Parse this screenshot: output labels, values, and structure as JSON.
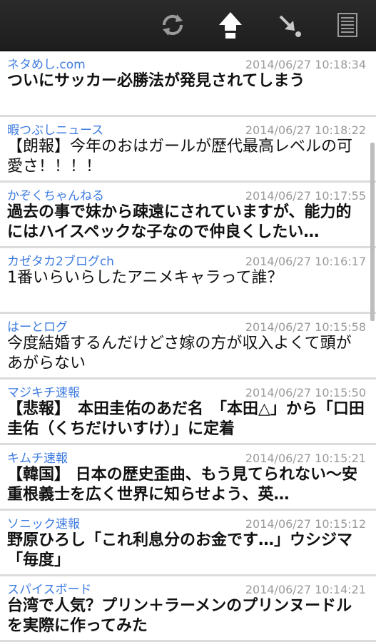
{
  "toolbar": {
    "icons": [
      "refresh-icon",
      "scroll-top-icon",
      "scroll-down-icon",
      "list-icon"
    ]
  },
  "items": [
    {
      "source": "ネタめし.com",
      "time": "2014/06/27 10:18:34",
      "title": "ついにサッカー必勝法が発見されてしまう",
      "bold": true
    },
    {
      "source": "暇つぶしニュース",
      "time": "2014/06/27 10:18:22",
      "title": "【朗報】今年のおはガールが歴代最高レベルの可愛さ！！！！",
      "bold": false
    },
    {
      "source": "かぞくちゃんねる",
      "time": "2014/06/27 10:17:55",
      "title": "過去の事で妹から疎遠にされていますが、能力的にはハイスペックな子なので仲良くしたい…",
      "bold": true
    },
    {
      "source": "カゼタカ2ブログch",
      "time": "2014/06/27 10:16:17",
      "title": "1番いらいらしたアニメキャラって誰？",
      "bold": false
    },
    {
      "source": "はーとログ",
      "time": "2014/06/27 10:15:58",
      "title": "今度結婚するんだけどさ嫁の方が収入よくて頭があがらない",
      "bold": false
    },
    {
      "source": "マジキチ速報",
      "time": "2014/06/27 10:15:50",
      "title": "【悲報】　本田圭佑のあだ名　「本田△」から「口田圭佑（くちだけいすけ）」に定着",
      "bold": true
    },
    {
      "source": "キムチ速報",
      "time": "2014/06/27 10:15:21",
      "title": "【韓国】 日本の歴史歪曲、もう見てられない～安重根義士を広く世界に知らせよう、英…",
      "bold": true
    },
    {
      "source": "ソニック速報",
      "time": "2014/06/27 10:15:12",
      "title": "野原ひろし「これ利息分のお金です…」ウシジマ「毎度」",
      "bold": true
    },
    {
      "source": "スパイスボード",
      "time": "2014/06/27 10:14:21",
      "title": "台湾で人気？プリン＋ラーメンのプリンヌードルを実際に作ってみた",
      "bold": true
    }
  ]
}
